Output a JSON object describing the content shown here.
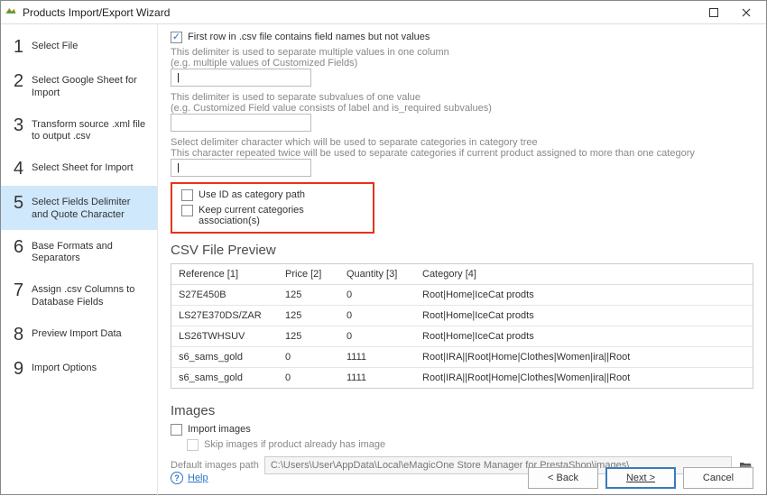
{
  "window": {
    "title": "Products Import/Export Wizard"
  },
  "sidebar": {
    "steps": [
      {
        "n": "1",
        "label": "Select File"
      },
      {
        "n": "2",
        "label": "Select Google Sheet for Import"
      },
      {
        "n": "3",
        "label": "Transform source .xml file to output .csv"
      },
      {
        "n": "4",
        "label": "Select Sheet for Import"
      },
      {
        "n": "5",
        "label": "Select Fields Delimiter and Quote Character"
      },
      {
        "n": "6",
        "label": "Base Formats and Separators"
      },
      {
        "n": "7",
        "label": "Assign .csv Columns to Database Fields"
      },
      {
        "n": "8",
        "label": "Preview Import Data"
      },
      {
        "n": "9",
        "label": "Import Options"
      }
    ]
  },
  "main": {
    "firstRow": "First row in .csv file contains field names but not values",
    "delim1a": "This delimiter is used to separate multiple values in one column",
    "delim1b": "(e.g. multiple values of Customized Fields)",
    "delim1value": "|",
    "delim2a": "This delimiter is used to separate subvalues of one value",
    "delim2b": "(e.g. Customized Field value consists of label and is_required subvalues)",
    "delim2value": "",
    "delim3a": "Select delimiter character which will be used to separate categories in category tree",
    "delim3b": "This character repeated twice will be used to separate categories if current product assigned to more than one category",
    "delim3value": "|",
    "useId": "Use ID as category path",
    "keepCat": "Keep current categories association(s)",
    "previewTitle": "CSV File Preview",
    "headers": {
      "ref": "Reference [1]",
      "price": "Price [2]",
      "qty": "Quantity [3]",
      "cat": "Category [4]"
    },
    "rows": [
      {
        "ref": "S27E450B",
        "price": "125",
        "qty": "0",
        "cat": "Root|Home|IceCat prodts"
      },
      {
        "ref": "LS27E370DS/ZAR",
        "price": "125",
        "qty": "0",
        "cat": "Root|Home|IceCat prodts"
      },
      {
        "ref": "LS26TWHSUV",
        "price": "125",
        "qty": "0",
        "cat": "Root|Home|IceCat prodts"
      },
      {
        "ref": "s6_sams_gold",
        "price": "0",
        "qty": "1111",
        "cat": "Root|IRA||Root|Home|Clothes|Women|ira||Root"
      },
      {
        "ref": "s6_sams_gold",
        "price": "0",
        "qty": "1111",
        "cat": "Root|IRA||Root|Home|Clothes|Women|ira||Root"
      }
    ],
    "imagesTitle": "Images",
    "importImages": "Import images",
    "skipImages": "Skip images if product already has image",
    "defaultPathLabel": "Default images path",
    "defaultPathValue": "C:\\Users\\User\\AppData\\Local\\eMagicOne Store Manager for PrestaShop\\images\\"
  },
  "footer": {
    "help": "Help",
    "back": "< Back",
    "next": "Next >",
    "cancel": "Cancel"
  }
}
